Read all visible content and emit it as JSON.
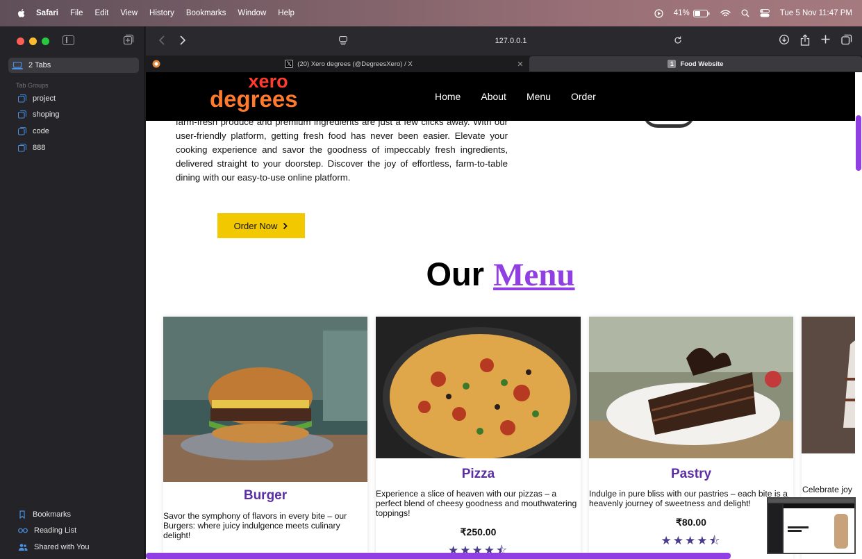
{
  "menubar": {
    "app_name": "Safari",
    "items": [
      "File",
      "Edit",
      "View",
      "History",
      "Bookmarks",
      "Window",
      "Help"
    ],
    "battery": "41%",
    "datetime": "Tue 5 Nov  11:47 PM"
  },
  "sidebar": {
    "tabs_label": "2 Tabs",
    "tab_groups_heading": "Tab Groups",
    "groups": [
      "project",
      "shoping",
      "code",
      "888"
    ],
    "bottom": {
      "bookmarks": "Bookmarks",
      "reading_list": "Reading List",
      "shared": "Shared with You"
    }
  },
  "toolbar": {
    "url": "127.0.0.1"
  },
  "tabs": {
    "x_tab": "(20) Xero degrees (@DegreesXero) / X",
    "food_badge": "1",
    "food_tab": "Food Website"
  },
  "site": {
    "logo_line1": "xero",
    "logo_line2": "degrees",
    "nav": [
      "Home",
      "About",
      "Menu",
      "Order"
    ],
    "about_text": "of culinary convenience. Explore a world of freshness at your fingertips, where farm-fresh produce and premium ingredients are just a few clicks away. With our user-friendly platform, getting fresh food has never been easier. Elevate your cooking experience and savor the goodness of impeccably fresh ingredients, delivered straight to your doorstep. Discover the joy of effortless, farm-to-table dining with our easy-to-use online platform.",
    "order_button": "Order Now",
    "menu_title_1": "Our",
    "menu_title_2": "Menu",
    "cards": [
      {
        "name": "Burger",
        "desc": "Savor the symphony of flavors in every bite – our Burgers: where juicy indulgence meets culinary delight!",
        "price": "",
        "rating": 0
      },
      {
        "name": "Pizza",
        "desc": "Experience a slice of heaven with our pizzas – a perfect blend of cheesy goodness and mouthwatering toppings!",
        "price": "₹250.00",
        "rating": 4.5
      },
      {
        "name": "Pastry",
        "desc": "Indulge in pure bliss with our pastries – each bite is a heavenly journey of sweetness and delight!",
        "price": "₹80.00",
        "rating": 4.5
      },
      {
        "name": "",
        "desc": "Celebrate joy",
        "price": "",
        "rating": 0
      }
    ]
  },
  "colors": {
    "accent": "#8f3fe2",
    "button": "#f2c800",
    "card_title": "#5b2fa3"
  }
}
